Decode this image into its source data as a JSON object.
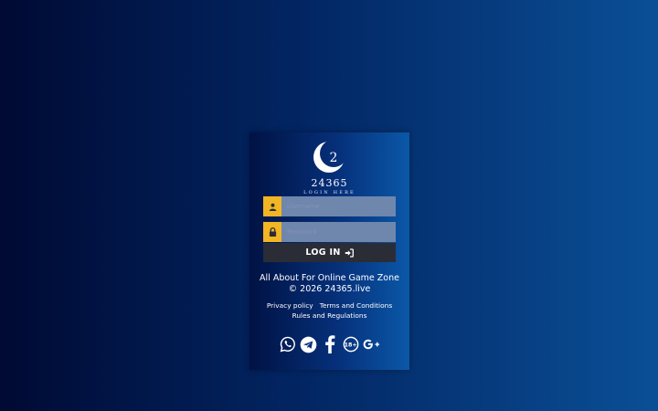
{
  "brand": {
    "logo_mark": "2",
    "name": "24365",
    "tagline": "LOGIN HERE"
  },
  "form": {
    "username_placeholder": "Username",
    "password_placeholder": "Password",
    "username_icon": "user-icon",
    "password_icon": "lock-icon",
    "login_label": "LOG IN",
    "login_icon": "sign-in-icon"
  },
  "footer": {
    "line1": "All About For Online Game Zone",
    "line2": "© 2026 24365.live",
    "links": {
      "privacy": "Privacy policy",
      "terms": "Terms and Conditions",
      "rules": "Rules and Regulations"
    },
    "social": [
      "whatsapp-icon",
      "telegram-icon",
      "facebook-icon",
      "18-plus-icon",
      "google-plus-icon"
    ]
  },
  "colors": {
    "accent": "#f2b524",
    "input_bg": "#6f86ad",
    "button_bg": "#2a2d36"
  }
}
